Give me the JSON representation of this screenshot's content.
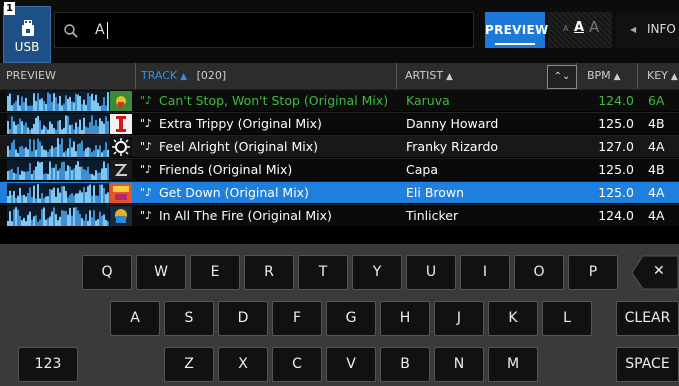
{
  "deck": {
    "number": "1"
  },
  "source": {
    "label": "USB",
    "icon": "usb-drive-icon"
  },
  "search": {
    "value": "A",
    "icon": "search-icon"
  },
  "toolbar": {
    "preview_label": "PREVIEW",
    "font_size_icon": "font-size-icon",
    "info_label": "INFO"
  },
  "columns": {
    "preview": "PREVIEW",
    "track": "TRACK",
    "track_count": "[020]",
    "artist": "ARTIST",
    "bpm": "BPM",
    "key": "KEY"
  },
  "tracks": [
    {
      "title": "Can't Stop, Won't Stop (Original Mix)",
      "artist": "Karuva",
      "bpm": "124.0",
      "key": "6A",
      "state": "playing"
    },
    {
      "title": "Extra Trippy (Original Mix)",
      "artist": "Danny Howard",
      "bpm": "125.0",
      "key": "4B",
      "state": "normal"
    },
    {
      "title": "Feel Alright (Original Mix)",
      "artist": "Franky Rizardo",
      "bpm": "127.0",
      "key": "4A",
      "state": "normal"
    },
    {
      "title": "Friends  (Original Mix)",
      "artist": "Capa",
      "bpm": "125.0",
      "key": "4B",
      "state": "normal"
    },
    {
      "title": "Get Down (Original Mix)",
      "artist": "Eli Brown",
      "bpm": "125.0",
      "key": "4A",
      "state": "selected"
    },
    {
      "title": "In All The Fire (Original Mix)",
      "artist": "Tinlicker",
      "bpm": "124.0",
      "key": "4A",
      "state": "normal"
    }
  ],
  "keyboard": {
    "row1": [
      "Q",
      "W",
      "E",
      "R",
      "T",
      "Y",
      "U",
      "I",
      "O",
      "P"
    ],
    "row2": [
      "A",
      "S",
      "D",
      "F",
      "G",
      "H",
      "J",
      "K",
      "L"
    ],
    "row3": [
      "Z",
      "X",
      "C",
      "V",
      "B",
      "N",
      "M"
    ],
    "numbers_label": "123",
    "clear_label": "CLEAR",
    "space_label": "SPACE",
    "backspace_label": "✕"
  },
  "colors": {
    "accent": "#1e7fde",
    "playing": "#3bbd3b",
    "usb": "#1e4f86"
  }
}
